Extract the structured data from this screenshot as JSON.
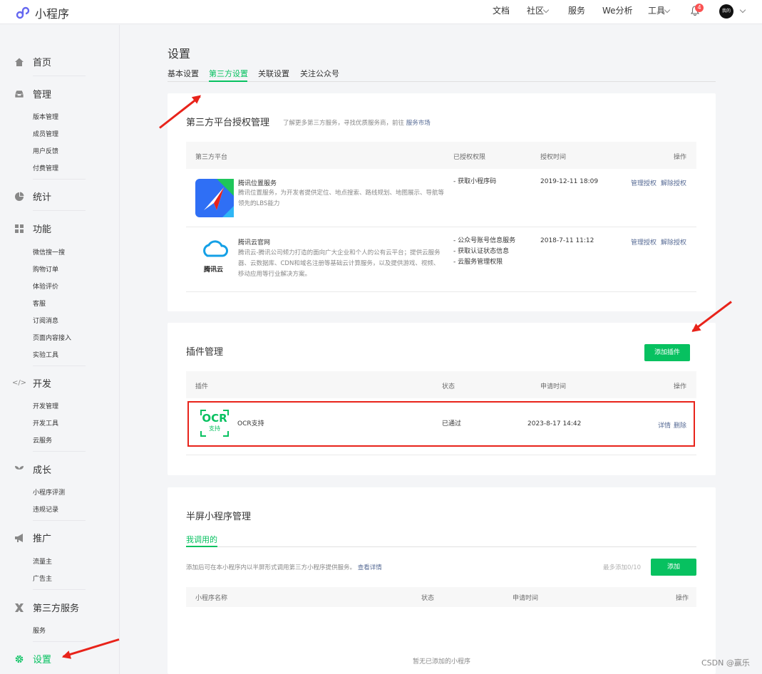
{
  "header": {
    "logo_text": "小程序",
    "nav": [
      "文档",
      "社区",
      "服务",
      "We分析",
      "工具"
    ],
    "notif_count": "4",
    "avatar_text": "我的"
  },
  "sidebar": {
    "sections": [
      {
        "label": "首页",
        "icon": "home-icon",
        "items": []
      },
      {
        "label": "管理",
        "icon": "inbox-icon",
        "items": [
          "版本管理",
          "成员管理",
          "用户反馈",
          "付费管理"
        ]
      },
      {
        "label": "统计",
        "icon": "pie-chart-icon",
        "items": []
      },
      {
        "label": "功能",
        "icon": "grid-icon",
        "items": [
          "微信搜一搜",
          "购物订单",
          "体验评价",
          "客服",
          "订阅消息",
          "页面内容接入",
          "实验工具"
        ]
      },
      {
        "label": "开发",
        "icon": "code-icon",
        "items": [
          "开发管理",
          "开发工具",
          "云服务"
        ]
      },
      {
        "label": "成长",
        "icon": "sprout-icon",
        "items": [
          "小程序评测",
          "违规记录"
        ]
      },
      {
        "label": "推广",
        "icon": "megaphone-icon",
        "items": [
          "流量主",
          "广告主"
        ]
      },
      {
        "label": "第三方服务",
        "icon": "third-party-icon",
        "items": [
          "服务"
        ]
      },
      {
        "label": "设置",
        "icon": "gear-icon",
        "items": []
      }
    ]
  },
  "main": {
    "title": "设置",
    "tabs": [
      "基本设置",
      "第三方设置",
      "关联设置",
      "关注公众号"
    ],
    "active_tab": "第三方设置",
    "auth_card": {
      "title": "第三方平台授权管理",
      "hint": "了解更多第三方服务，寻找优质服务商，前往",
      "hint_link": "服务市场",
      "columns": [
        "第三方平台",
        "已授权权限",
        "授权时间",
        "操作"
      ],
      "rows": [
        {
          "name": "腾讯位置服务",
          "desc": "腾讯位置服务，为开发者提供定位、地点搜索、路线规划、地图展示、导航等领先的LBS能力",
          "perms": "- 获取小程序码",
          "time": "2019-12-11 18:09",
          "action1": "管理授权",
          "action2": "解除授权"
        },
        {
          "name": "腾讯云官网",
          "desc": "腾讯云-腾讯公司倾力打造的面向广大企业和个人的公有云平台；提供云服务器、云数据库、CDN和域名注册等基础云计算服务，以及提供游戏、视频、移动应用等行业解决方案。",
          "perms": "- 公众号账号信息服务\n- 获取认证状态信息\n- 云服务管理权限",
          "time": "2018-7-11 11:12",
          "action1": "管理授权",
          "action2": "解除授权",
          "logo_text": "腾讯云"
        }
      ]
    },
    "plugin_card": {
      "title": "插件管理",
      "add_button": "添加插件",
      "columns": [
        "插件",
        "状态",
        "申请时间",
        "操作"
      ],
      "rows": [
        {
          "logo_big": "OCR",
          "logo_small": "支持",
          "name": "OCR支持",
          "status": "已通过",
          "time": "2023-8-17 14:42",
          "action1": "详情",
          "action2": "删除"
        }
      ]
    },
    "halfscreen_card": {
      "title": "半屏小程序管理",
      "tab": "我调用的",
      "desc": "添加后可在本小程序内以半屏形式调用第三方小程序提供服务。",
      "desc_link": "查看详情",
      "quota": "最多添加0/10",
      "add_button": "添加",
      "columns": [
        "小程序名称",
        "状态",
        "申请时间",
        "操作"
      ],
      "empty": "暂无已添加的小程序"
    }
  },
  "watermark": "CSDN @赢乐",
  "colors": {
    "accent": "#07c160",
    "link": "#576b95",
    "annotation": "#e8231a"
  }
}
